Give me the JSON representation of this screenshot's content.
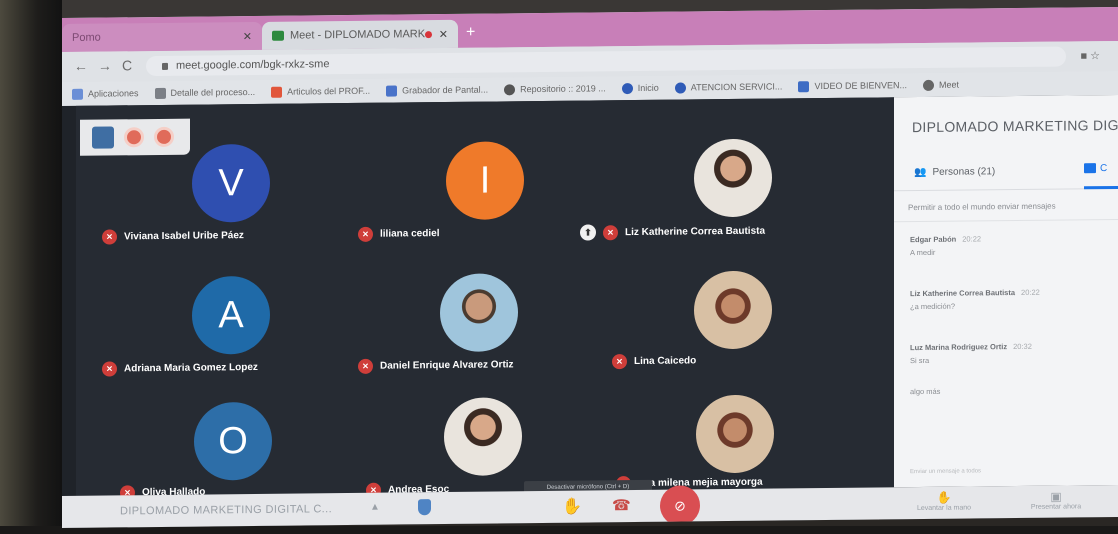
{
  "browser": {
    "tab_inactive": "Pomo",
    "tab_active": "Meet - DIPLOMADO MARK",
    "url": "meet.google.com/bgk-rxkz-sme",
    "bookmarks": [
      "Aplicaciones",
      "Detalle del proceso...",
      "Articulos del PROF...",
      "Grabador de Pantal...",
      "Repositorio :: 2019 ...",
      "Inicio",
      "ATENCION SERVICI...",
      "VIDEO DE BIENVEN...",
      "Meet"
    ]
  },
  "participants": [
    {
      "name": "Viviana Isabel Uribe Páez",
      "initial": "V",
      "color": "#2f4fb0"
    },
    {
      "name": "liliana cediel",
      "initial": "I",
      "color": "#ef7a2a"
    },
    {
      "name": "Liz Katherine Correa Bautista",
      "initial": "",
      "color": ""
    },
    {
      "name": "Adriana Maria Gomez Lopez",
      "initial": "A",
      "color": "#1f6aa8"
    },
    {
      "name": "Daniel Enrique Alvarez Ortiz",
      "initial": "",
      "color": ""
    },
    {
      "name": "Lina Caicedo",
      "initial": "",
      "color": ""
    },
    {
      "name": "Oliva Hallado",
      "initial": "O",
      "color": "#2d6ea8"
    },
    {
      "name": "Andrea Esoc",
      "initial": "",
      "color": ""
    },
    {
      "name": "ana milena mejia mayorga",
      "initial": "",
      "color": ""
    }
  ],
  "tooltip": "Desactivar micrófono (Ctrl + D)",
  "side": {
    "title": "DIPLOMADO MARKETING DIG",
    "people_tab": "Personas (21)",
    "chat_tab": "C",
    "permission": "Permitir a todo el mundo enviar mensajes",
    "messages": [
      {
        "who": "Edgar Pabón",
        "time": "20:22",
        "text": "A medir"
      },
      {
        "who": "Liz Katherine Correa Bautista",
        "time": "20:22",
        "text": "¿a medición?"
      },
      {
        "who": "Luz Marina Rodriguez Ortiz",
        "time": "20:32",
        "text": "Si sra"
      },
      {
        "who": "",
        "time": "",
        "text": "algo más"
      }
    ],
    "send_hint": "Enviar un mensaje a todos"
  },
  "bottom": {
    "meeting_title": "DIPLOMADO MARKETING DIGITAL C...",
    "raise_hand": "Levantar la mano",
    "present": "Presentar ahora"
  }
}
